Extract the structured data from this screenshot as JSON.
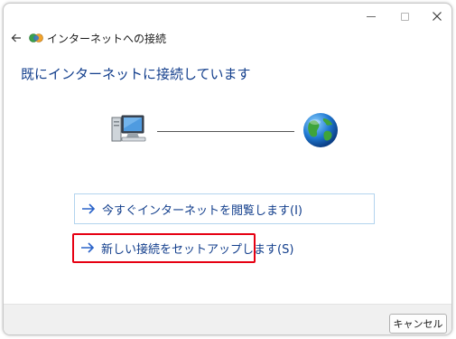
{
  "window": {
    "title": "インターネットへの接続",
    "minimize_icon": "minimize-icon",
    "maximize_icon": "maximize-icon",
    "close_icon": "close-icon"
  },
  "main": {
    "heading": "既にインターネットに接続しています",
    "diagram": {
      "computer_icon": "computer-icon",
      "globe_icon": "globe-icon"
    },
    "links": [
      {
        "label": "今すぐインターネットを閲覧します(I)",
        "icon": "arrow-right-icon"
      },
      {
        "label": "新しい接続をセットアップします(S)",
        "icon": "arrow-right-icon",
        "highlighted": true
      }
    ]
  },
  "footer": {
    "cancel_label": "キャンセル"
  },
  "colors": {
    "heading": "#123e8c",
    "link_text": "#123e8c",
    "link_arrow": "#2a63c9",
    "highlight": "#e60012",
    "footer_bg": "#f0f0f0"
  }
}
